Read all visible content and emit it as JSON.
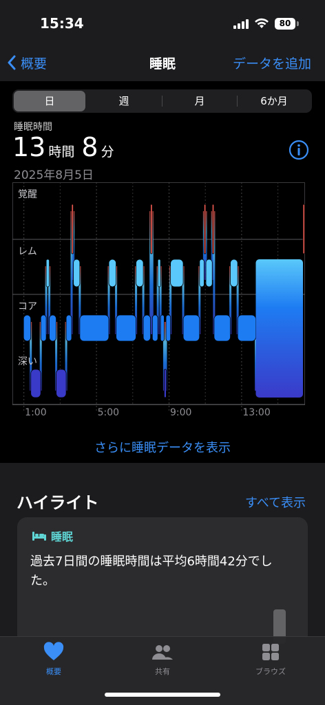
{
  "status_bar": {
    "time": "15:34",
    "battery": "80"
  },
  "nav": {
    "back_label": "概要",
    "title": "睡眠",
    "add_label": "データを追加"
  },
  "segments": [
    "日",
    "週",
    "月",
    "6か月"
  ],
  "selected_segment": "日",
  "summary": {
    "label": "睡眠時間",
    "hours": "13",
    "hours_unit": "時間",
    "minutes": "8",
    "minutes_unit": "分",
    "date": "2025年8月5日"
  },
  "chart_data": {
    "type": "hypnogram",
    "stages": [
      "覚醒",
      "レム",
      "コア",
      "深い"
    ],
    "x_ticks": [
      "1:00",
      "5:00",
      "9:00",
      "13:00"
    ],
    "x_range_hours": [
      0.5,
      16.4
    ],
    "segments": [
      {
        "stage": "コア",
        "start": 1.0,
        "end": 1.4
      },
      {
        "stage": "深い",
        "start": 1.4,
        "end": 1.95
      },
      {
        "stage": "コア",
        "start": 1.95,
        "end": 2.25
      },
      {
        "stage": "レム",
        "start": 2.25,
        "end": 2.42
      },
      {
        "stage": "コア",
        "start": 2.42,
        "end": 2.8
      },
      {
        "stage": "深い",
        "start": 2.8,
        "end": 3.35
      },
      {
        "stage": "コア",
        "start": 3.35,
        "end": 3.65
      },
      {
        "stage": "覚醒",
        "start": 3.65,
        "end": 3.75
      },
      {
        "stage": "レム",
        "start": 3.75,
        "end": 4.1
      },
      {
        "stage": "コア",
        "start": 4.1,
        "end": 5.7
      },
      {
        "stage": "レム",
        "start": 5.7,
        "end": 6.1
      },
      {
        "stage": "コア",
        "start": 6.1,
        "end": 7.2
      },
      {
        "stage": "レム",
        "start": 7.2,
        "end": 7.6
      },
      {
        "stage": "コア",
        "start": 7.6,
        "end": 8.0
      },
      {
        "stage": "覚醒",
        "start": 8.0,
        "end": 8.1
      },
      {
        "stage": "コア",
        "start": 8.1,
        "end": 8.4
      },
      {
        "stage": "レム",
        "start": 8.4,
        "end": 8.55
      },
      {
        "stage": "コア",
        "start": 8.55,
        "end": 8.75
      },
      {
        "stage": "深い",
        "start": 8.75,
        "end": 8.85
      },
      {
        "stage": "コア",
        "start": 8.85,
        "end": 9.1
      },
      {
        "stage": "レム",
        "start": 9.1,
        "end": 9.8
      },
      {
        "stage": "コア",
        "start": 9.8,
        "end": 10.7
      },
      {
        "stage": "レム",
        "start": 10.7,
        "end": 10.95
      },
      {
        "stage": "覚醒",
        "start": 10.95,
        "end": 11.05
      },
      {
        "stage": "レム",
        "start": 11.05,
        "end": 11.4
      },
      {
        "stage": "覚醒",
        "start": 11.4,
        "end": 11.5
      },
      {
        "stage": "コア",
        "start": 11.5,
        "end": 12.4
      },
      {
        "stage": "レム",
        "start": 12.4,
        "end": 12.8
      },
      {
        "stage": "コア",
        "start": 12.8,
        "end": 13.8
      },
      {
        "stage": "深い",
        "start": 13.8,
        "end": 16.4
      },
      {
        "stage": "覚醒",
        "start": 16.4,
        "end": 16.5
      }
    ],
    "colors": {
      "覚醒": "#e8584e",
      "レム": "#5ac8fa",
      "コア": "#1e7cf2",
      "深い": "#3a3ac8"
    }
  },
  "more_link": "さらに睡眠データを表示",
  "highlights": {
    "title": "ハイライト",
    "show_all": "すべて表示",
    "card_tag": "睡眠",
    "card_text": "過去7日間の睡眠時間は平均6時間42分でした。"
  },
  "tabs": [
    {
      "label": "概要",
      "icon": "heart-icon",
      "active": true
    },
    {
      "label": "共有",
      "icon": "people-icon",
      "active": false
    },
    {
      "label": "ブラウズ",
      "icon": "grid-icon",
      "active": false
    }
  ]
}
